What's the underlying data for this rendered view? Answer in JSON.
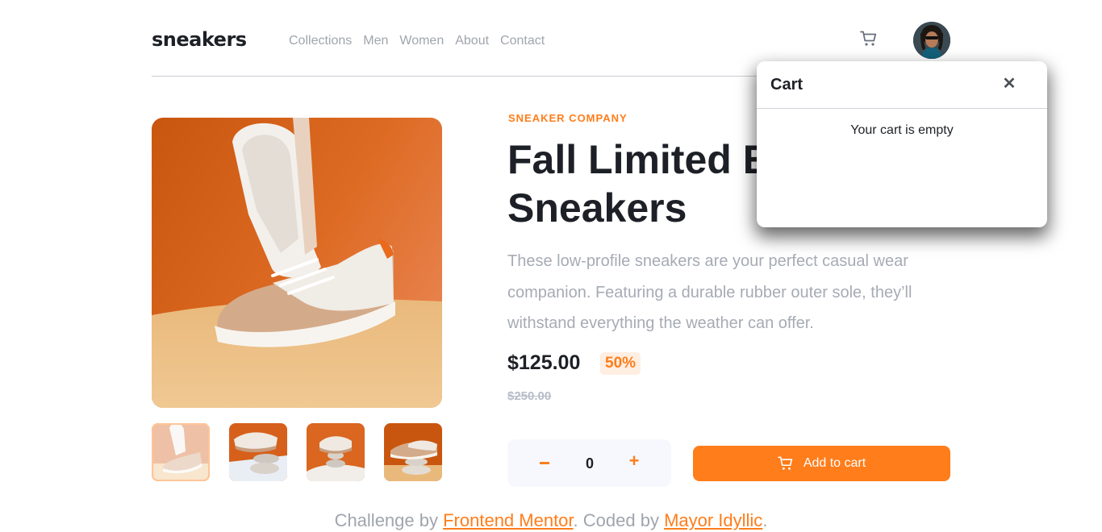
{
  "header": {
    "logo": "sneakers",
    "nav": [
      "Collections",
      "Men",
      "Women",
      "About",
      "Contact"
    ]
  },
  "product": {
    "company": "SNEAKER COMPANY",
    "title": "Fall Limited Edition Sneakers",
    "description": "These low-profile sneakers are your perfect casual wear companion. Featuring a durable rubber outer sole, they’ll withstand everything the weather can offer.",
    "price": "$125.00",
    "discount": "50%",
    "old_price": "$250.00",
    "quantity": "0",
    "add_to_cart": "Add to cart"
  },
  "cart": {
    "title": "Cart",
    "empty_message": "Your cart is empty"
  },
  "footer": {
    "text_before": "Challenge by ",
    "link1": "Frontend Mentor",
    "text_middle": ". Coded by ",
    "link2": "Mayor Idyllic",
    "text_after": "."
  },
  "colors": {
    "accent": "#ff7d1a",
    "accent_light": "#ffeee2",
    "dark": "#1d2026",
    "muted": "#a6abb4"
  },
  "icons": [
    "cart-icon",
    "avatar-photo",
    "close-icon",
    "minus-icon",
    "plus-icon"
  ]
}
